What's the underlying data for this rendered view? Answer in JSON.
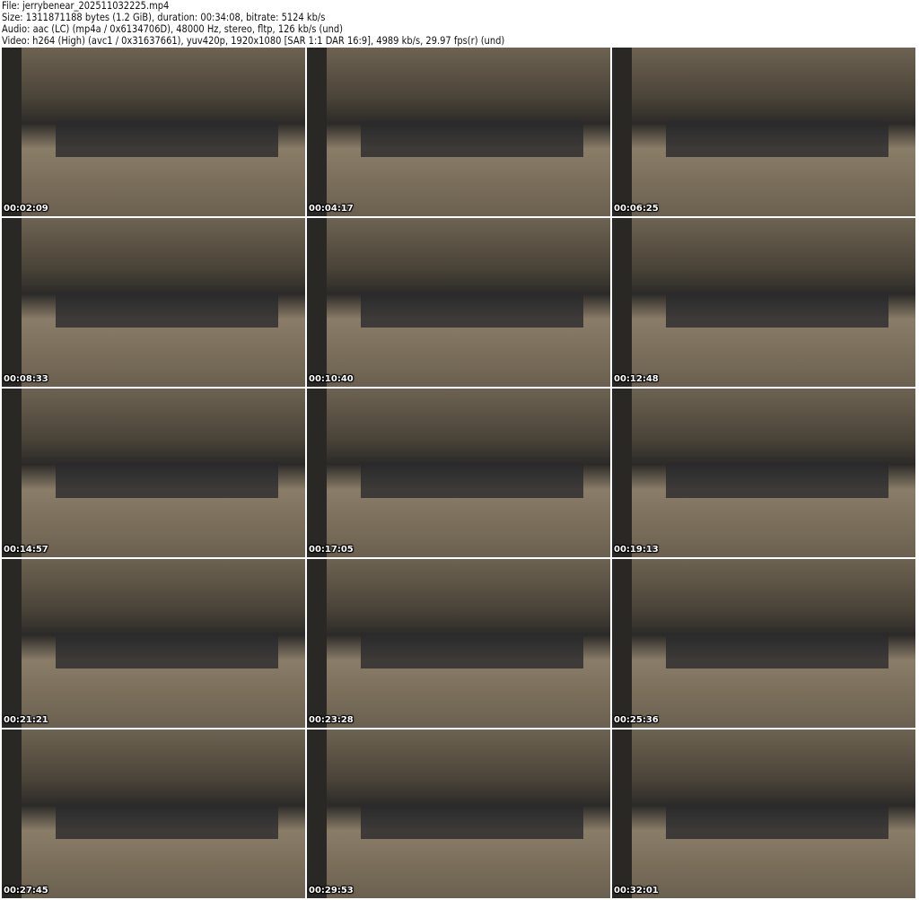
{
  "header": {
    "file": "File: jerrybenear_202511032225.mp4",
    "size": "Size: 1311871188 bytes (1.2 GiB), duration: 00:34:08, bitrate: 5124 kb/s",
    "audio": "Audio: aac (LC) (mp4a / 0x6134706D), 48000 Hz, stereo, fltp, 126 kb/s (und)",
    "video": "Video: h264 (High) (avc1 / 0x31637661), yuv420p, 1920x1080 [SAR 1:1 DAR 16:9], 4989 kb/s, 29.97 fps(r) (und)"
  },
  "thumbnails": [
    {
      "timestamp": "00:02:09"
    },
    {
      "timestamp": "00:04:17"
    },
    {
      "timestamp": "00:06:25"
    },
    {
      "timestamp": "00:08:33"
    },
    {
      "timestamp": "00:10:40"
    },
    {
      "timestamp": "00:12:48"
    },
    {
      "timestamp": "00:14:57"
    },
    {
      "timestamp": "00:17:05"
    },
    {
      "timestamp": "00:19:13"
    },
    {
      "timestamp": "00:21:21"
    },
    {
      "timestamp": "00:23:28"
    },
    {
      "timestamp": "00:25:36"
    },
    {
      "timestamp": "00:27:45"
    },
    {
      "timestamp": "00:29:53"
    },
    {
      "timestamp": "00:32:01"
    }
  ]
}
